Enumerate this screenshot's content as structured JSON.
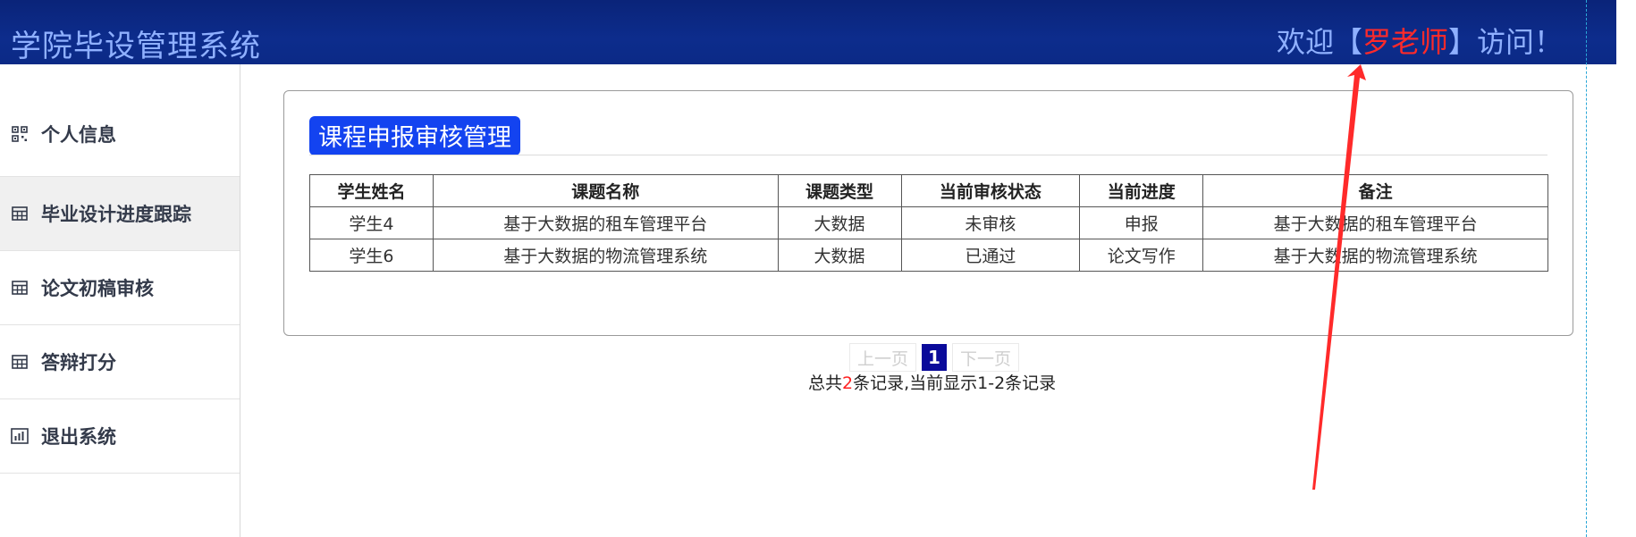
{
  "header": {
    "app_title": "学院毕设管理系统",
    "welcome_prefix": "欢迎【",
    "user_name": "罗老师",
    "welcome_suffix": "】访问！"
  },
  "sidebar": {
    "items": [
      {
        "label": "个人信息",
        "icon": "qrcode-icon"
      },
      {
        "label": "毕业设计进度跟踪",
        "icon": "table-icon",
        "active": true
      },
      {
        "label": "论文初稿审核",
        "icon": "table-icon"
      },
      {
        "label": "答辩打分",
        "icon": "table-icon"
      },
      {
        "label": "退出系统",
        "icon": "bar-chart-icon"
      }
    ]
  },
  "main": {
    "title": "课程申报审核管理",
    "table": {
      "headers": [
        "学生姓名",
        "课题名称",
        "课题类型",
        "当前审核状态",
        "当前进度",
        "备注"
      ],
      "rows": [
        [
          "学生4",
          "基于大数据的租车管理平台",
          "大数据",
          "未审核",
          "申报",
          "基于大数据的租车管理平台"
        ],
        [
          "学生6",
          "基于大数据的物流管理系统",
          "大数据",
          "已通过",
          "论文写作",
          "基于大数据的物流管理系统"
        ]
      ]
    },
    "pager": {
      "prev": "上一页",
      "current": "1",
      "next": "下一页",
      "summary_prefix": "总共",
      "total": "2",
      "summary_suffix": "条记录,当前显示1-2条记录"
    }
  },
  "colors": {
    "header_bg": "#0b2a86",
    "title_badge": "#1343f0",
    "accent_red": "#ff2a2a",
    "annotation_arrow": "#ff2a2a"
  }
}
